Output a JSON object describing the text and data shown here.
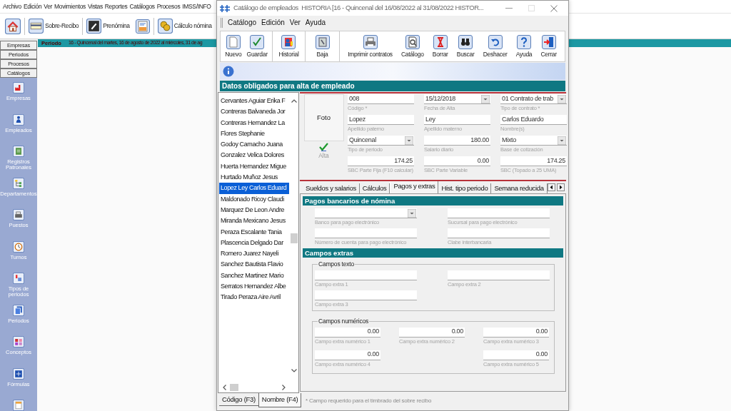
{
  "app": {
    "menu": [
      "Archivo",
      "Edición",
      "Ver",
      "Movimientos",
      "Vistas",
      "Reportes",
      "Catálogos",
      "Procesos",
      "IMSS/INFO"
    ],
    "toolbar": [
      {
        "label": "Sobre-Recibo"
      },
      {
        "label": "Prenómina"
      },
      {
        "label": "Cálculo nómina"
      }
    ],
    "period_bar": {
      "label": "Periodo",
      "text": "16 - Quincenal del martes, 16 de agosto de 2022 al miércoles, 31 de ag"
    },
    "sidebar": {
      "tabs": [
        "Empresas",
        "Periodos",
        "Procesos",
        "Catálogos"
      ],
      "items": [
        {
          "label": "Empresas"
        },
        {
          "label": "Empleados"
        },
        {
          "label": "Registros Patronales"
        },
        {
          "label": "Departamentos"
        },
        {
          "label": "Puestos"
        },
        {
          "label": "Turnos"
        },
        {
          "label": "Tipos de periodos"
        },
        {
          "label": "Periodos"
        },
        {
          "label": "Conceptos"
        },
        {
          "label": "Fórmulas"
        }
      ]
    }
  },
  "dialog": {
    "title": "Catálogo de empleados  HISTORIA [16 - Quincenal del 16/08/2022 al 31/08/2022 HISTOR...",
    "menu": [
      "Catálogo",
      "Edición",
      "Ver",
      "Ayuda"
    ],
    "toolbar": [
      [
        {
          "label": "Nuevo"
        },
        {
          "label": "Guardar"
        }
      ],
      [
        {
          "label": "Historial"
        }
      ],
      [
        {
          "label": "Baja"
        }
      ],
      [
        {
          "label": "Imprimir contratos"
        },
        {
          "label": "Catálogo"
        },
        {
          "label": "Borrar"
        },
        {
          "label": "Buscar"
        },
        {
          "label": "Deshacer"
        },
        {
          "label": "Ayuda"
        },
        {
          "label": "Cerrar"
        }
      ]
    ],
    "section_title": "Datos obligados para alta de empleado",
    "employees": [
      {
        "name": "Cervantes Aguiar Erika F",
        "selected": false
      },
      {
        "name": "Contreras Balvaneda Jor",
        "selected": false
      },
      {
        "name": "Contreras Hernandez La",
        "selected": false
      },
      {
        "name": "Flores  Stephanie",
        "selected": false
      },
      {
        "name": "Godoy Camacho Juana",
        "selected": false
      },
      {
        "name": "Gonzalez Velica Dolores",
        "selected": false
      },
      {
        "name": "Huerta Hernandez Migue",
        "selected": false
      },
      {
        "name": "Hurtado Muñoz Jesus",
        "selected": false
      },
      {
        "name": "Lopez Ley Carlos Eduard",
        "selected": true
      },
      {
        "name": "Maldonado Ricoy Claudi",
        "selected": false
      },
      {
        "name": "Marquez De Leon Andre",
        "selected": false
      },
      {
        "name": "Miranda Mexicano Jesus",
        "selected": false
      },
      {
        "name": "Peraza Escalante Tania",
        "selected": false
      },
      {
        "name": "Plascencia Delgado Dar",
        "selected": false
      },
      {
        "name": "Romero Juarez Nayeli",
        "selected": false
      },
      {
        "name": "Sanchez Bautista Flavio",
        "selected": false
      },
      {
        "name": "Sanchez Martinez Mario",
        "selected": false
      },
      {
        "name": "Serratos Hernandez Albe",
        "selected": false
      },
      {
        "name": "Tirado Peraza Aire Avril",
        "selected": false
      }
    ],
    "list_tabs": [
      {
        "label": "Código (F3)",
        "selected": false
      },
      {
        "label": "Nombre (F4)",
        "selected": true
      }
    ],
    "form": {
      "photo": "Foto",
      "status": "Alta",
      "fields": [
        {
          "kind": "text",
          "value": "008",
          "label": "Código *"
        },
        {
          "kind": "combo",
          "value": "15/12/2018",
          "label": "Fecha de Alta"
        },
        {
          "kind": "combo",
          "value": "01 Contrato de trab",
          "label": "Tipo de contrato *"
        },
        {
          "kind": "text",
          "value": "Lopez",
          "label": "Apellido paterno"
        },
        {
          "kind": "text",
          "value": "Ley",
          "label": "Apellido materno"
        },
        {
          "kind": "text",
          "value": "Carlos Eduardo",
          "label": "Nombre(s)"
        },
        {
          "kind": "combo",
          "value": "Quincenal",
          "label": "Tipo de periodo"
        },
        {
          "kind": "number",
          "value": "180.00",
          "label": "Salario diario"
        },
        {
          "kind": "combo",
          "value": "Mixto",
          "label": "Base de cotización"
        },
        {
          "kind": "number",
          "value": "174.25",
          "label": "SBC Parte Fija (F10 calcular)"
        },
        {
          "kind": "number",
          "value": "0.00",
          "label": "SBC Parte Variable"
        },
        {
          "kind": "number",
          "value": "174.25",
          "label": "SBC (Topado a 25 UMA)"
        }
      ]
    },
    "tabs": [
      {
        "label": "Sueldos y salarios",
        "selected": false
      },
      {
        "label": "Cálculos",
        "selected": false
      },
      {
        "label": "Pagos y extras",
        "selected": true
      },
      {
        "label": "Hist. tipo periodo",
        "selected": false
      },
      {
        "label": "Semana reducida",
        "selected": false
      }
    ],
    "tab_panel": {
      "sections": [
        {
          "title": "Pagos bancarios de nómina",
          "fields": [
            {
              "kind": "combo",
              "label": "Banco para pago electrónico"
            },
            {
              "kind": "text",
              "label": "Sucursal para pago electrónico"
            },
            {
              "kind": "text",
              "label": "Número de cuenta para pago electrónico"
            },
            {
              "kind": "text",
              "label": "Clabe interbancaria"
            }
          ]
        },
        {
          "title": "Campos extras",
          "groups": [
            {
              "title": "Campos texto",
              "fields": [
                {
                  "kind": "text",
                  "label": "Campo extra 1"
                },
                {
                  "kind": "text",
                  "label": "Campo extra 2"
                },
                {
                  "kind": "text",
                  "label": "Campo extra 3"
                }
              ]
            },
            {
              "title": "Campos numéricos",
              "fields": [
                {
                  "kind": "number",
                  "value": "0.00",
                  "label": "Campo extra numérico 1"
                },
                {
                  "kind": "number",
                  "value": "0.00",
                  "label": "Campo extra numérico 2"
                },
                {
                  "kind": "number",
                  "value": "0.00",
                  "label": "Campo extra numérico 3"
                },
                {
                  "kind": "number",
                  "value": "0.00",
                  "label": "Campo extra numérico 4"
                },
                {
                  "kind": "number",
                  "value": "0.00",
                  "label": "Campo extra numérico 5"
                }
              ]
            }
          ]
        }
      ]
    },
    "footnote": "* Campo requerido para el timbrado del sobre recibo"
  }
}
